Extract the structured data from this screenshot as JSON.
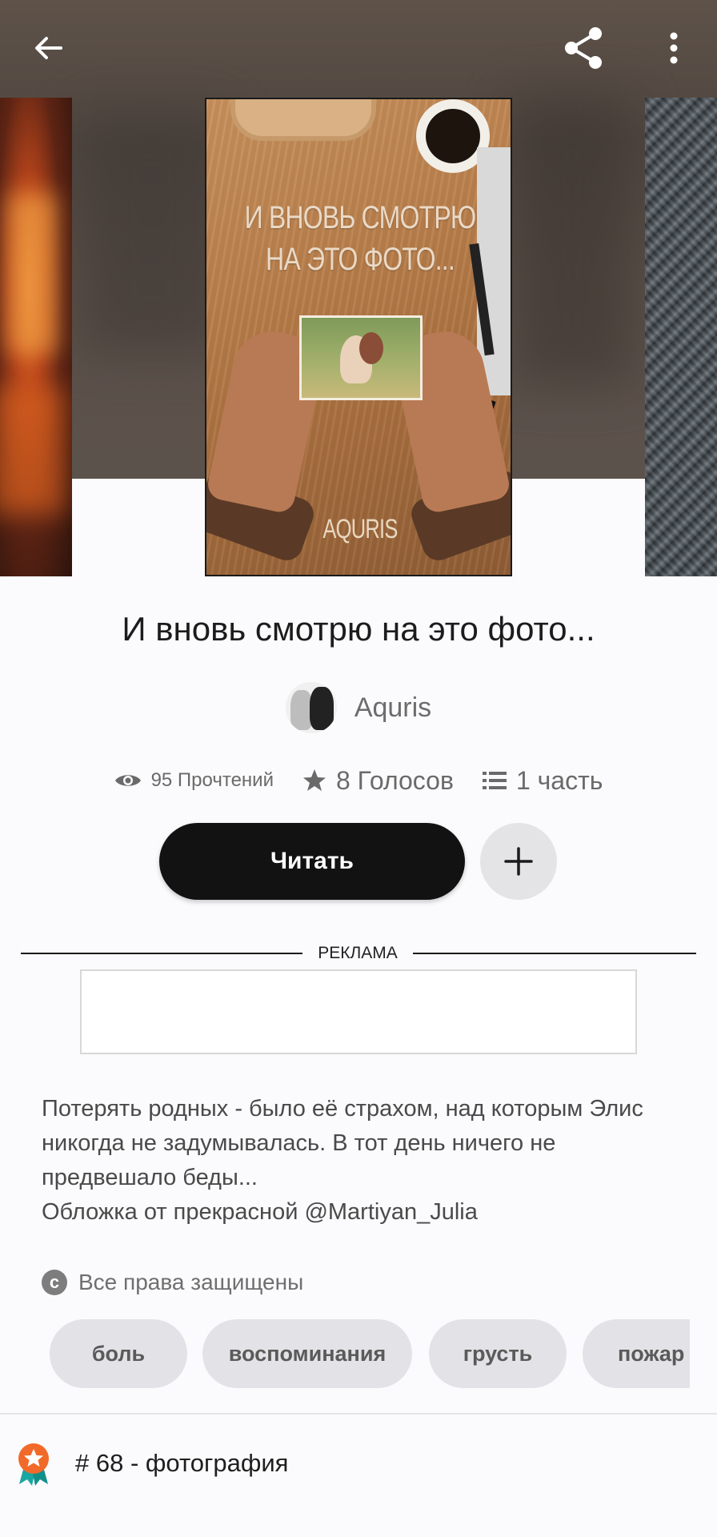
{
  "cover": {
    "title_art": "И ВНОВЬ СМОТРЮ НА ЭТО ФОТО...",
    "author_art": "AQURIS"
  },
  "story": {
    "title": "И вновь смотрю на это фото...",
    "author": "Aquris"
  },
  "stats": {
    "reads": "95 Прочтений",
    "votes": "8 Голосов",
    "parts": "1 часть"
  },
  "actions": {
    "read_label": "Читать"
  },
  "ad": {
    "label": "РЕКЛАМА"
  },
  "description": {
    "line1": "Потерять родных - было её страхом, над которым Элис никогда не задумывалась. В тот день ничего не предвешало беды...",
    "line2": "Обложка от прекрасной @Martiyan_Julia"
  },
  "copyright": "Все права защищены",
  "tags": [
    "боль",
    "воспоминания",
    "грусть",
    "пожар"
  ],
  "ranking": "# 68 - фотография",
  "icons": [
    "back-arrow-icon",
    "share-icon",
    "more-vertical-icon",
    "eye-icon",
    "star-icon",
    "list-icon",
    "plus-icon",
    "copyright-icon",
    "rank-badge-icon"
  ],
  "colors": {
    "primary_button": "#121212",
    "secondary_button": "#e4e3e6",
    "tag_bg": "#e3e2e6",
    "badge": "#f26a2a",
    "badge_ribbon": "#1aa6a1"
  }
}
